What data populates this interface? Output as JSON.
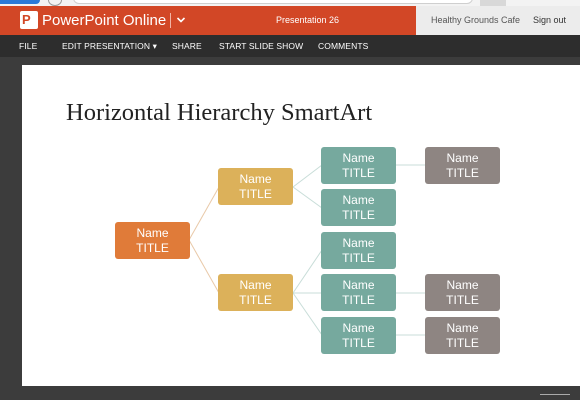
{
  "app": {
    "name": "PowerPoint Online",
    "document_title": "Presentation 26",
    "user_name": "Healthy Grounds Cafe",
    "sign_out_label": "Sign out",
    "brand_color": "#d24726"
  },
  "menu": {
    "items": [
      {
        "label": "FILE"
      },
      {
        "label": "EDIT PRESENTATION ▾"
      },
      {
        "label": "SHARE"
      },
      {
        "label": "START SLIDE SHOW"
      },
      {
        "label": "COMMENTS"
      }
    ]
  },
  "slide": {
    "title": "Horizontal Hierarchy SmartArt",
    "nodes": {
      "root": {
        "name": "Name",
        "title": "TITLE"
      },
      "branch_a": {
        "name": "Name",
        "title": "TITLE"
      },
      "branch_b": {
        "name": "Name",
        "title": "TITLE"
      },
      "a_child_1": {
        "name": "Name",
        "title": "TITLE"
      },
      "a_child_2": {
        "name": "Name",
        "title": "TITLE"
      },
      "a_child_1_leaf": {
        "name": "Name",
        "title": "TITLE"
      },
      "b_child_1": {
        "name": "Name",
        "title": "TITLE"
      },
      "b_child_2": {
        "name": "Name",
        "title": "TITLE"
      },
      "b_child_3": {
        "name": "Name",
        "title": "TITLE"
      },
      "b_child_2_leaf": {
        "name": "Name",
        "title": "TITLE"
      },
      "b_child_3_leaf": {
        "name": "Name",
        "title": "TITLE"
      }
    },
    "colors": {
      "level0": "#e07b39",
      "level1": "#dcb15a",
      "level2": "#76a99e",
      "level3": "#8e8582"
    }
  }
}
